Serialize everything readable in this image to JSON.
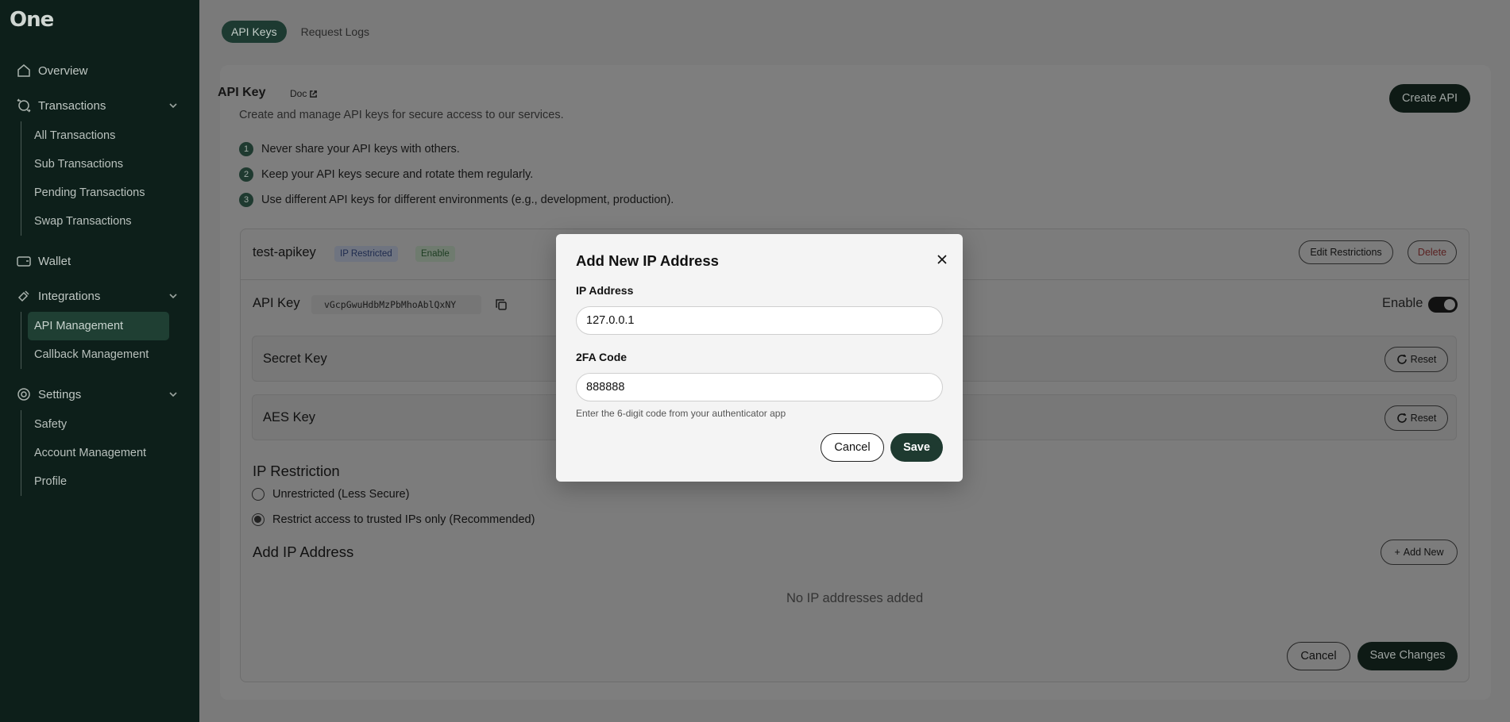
{
  "sidebar": {
    "logo": "One",
    "overview": "Overview",
    "transactions": {
      "label": "Transactions",
      "items": [
        "All Transactions",
        "Sub Transactions",
        "Pending Transactions",
        "Swap Transactions"
      ]
    },
    "wallet": "Wallet",
    "integrations": {
      "label": "Integrations",
      "items": [
        "API Management",
        "Callback Management"
      ]
    },
    "settings": {
      "label": "Settings",
      "items": [
        "Safety",
        "Account Management",
        "Profile"
      ]
    }
  },
  "tabs": [
    "API Keys",
    "Request Logs"
  ],
  "header": {
    "title": "API Key",
    "doc": "Doc",
    "subtitle": "Create and manage API keys for secure access to our services.",
    "create_button": "Create API"
  },
  "rules": [
    {
      "num": "1",
      "text": "Never share your API keys with others."
    },
    {
      "num": "2",
      "text": "Keep your API keys secure and rotate them regularly."
    },
    {
      "num": "3",
      "text": "Use different API keys for different environments (e.g., development, production)."
    }
  ],
  "key": {
    "name": "test-apikey",
    "badge_ip": "IP Restricted",
    "badge_enable": "Enable",
    "edit_button": "Edit Restrictions",
    "delete_button": "Delete",
    "api_key_label": "API Key",
    "api_key_value": "vGcpGwuHdbMzPbMhoAblQxNY",
    "enable_label": "Enable",
    "secret_label": "Secret Key",
    "aes_label": "AES Key",
    "reset_label": "Reset"
  },
  "restriction": {
    "title": "IP Restriction",
    "option_unrestricted": "Unrestricted (Less Secure)",
    "option_restricted": "Restrict access to trusted IPs only (Recommended)",
    "add_title": "Add IP Address",
    "add_button": "Add New",
    "empty": "No IP addresses added",
    "cancel": "Cancel",
    "save_changes": "Save Changes"
  },
  "modal": {
    "title": "Add New IP Address",
    "ip_label": "IP Address",
    "ip_value": "127.0.0.1",
    "code_label": "2FA Code",
    "code_value": "888888",
    "hint": "Enter the 6-digit code from your authenticator app",
    "cancel": "Cancel",
    "save": "Save"
  }
}
